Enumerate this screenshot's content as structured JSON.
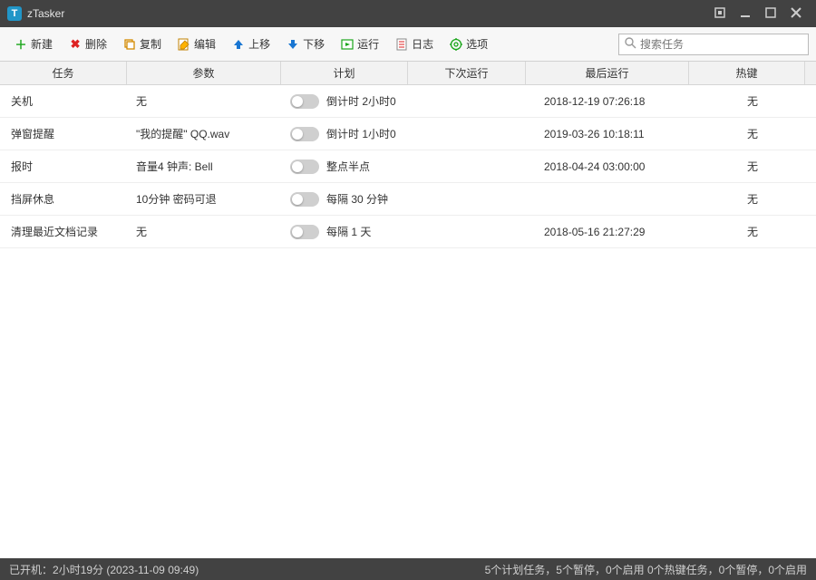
{
  "app": {
    "title": "zTasker"
  },
  "toolbar": {
    "new_label": "新建",
    "delete_label": "删除",
    "copy_label": "复制",
    "edit_label": "编辑",
    "up_label": "上移",
    "down_label": "下移",
    "run_label": "运行",
    "log_label": "日志",
    "options_label": "选项"
  },
  "search": {
    "placeholder": "搜索任务"
  },
  "columns": {
    "task": "任务",
    "param": "参数",
    "plan": "计划",
    "next": "下次运行",
    "last": "最后运行",
    "hotkey": "热键"
  },
  "tasks": [
    {
      "name": "关机",
      "param": "无",
      "enabled": false,
      "plan": "倒计时 2小时0",
      "next": "",
      "last": "2018-12-19 07:26:18",
      "hotkey": "无"
    },
    {
      "name": "弹窗提醒",
      "param": "\"我的提醒\" QQ.wav",
      "enabled": false,
      "plan": "倒计时 1小时0",
      "next": "",
      "last": "2019-03-26 10:18:11",
      "hotkey": "无"
    },
    {
      "name": "报时",
      "param": "音量4 钟声: Bell",
      "enabled": false,
      "plan": "整点半点",
      "next": "",
      "last": "2018-04-24 03:00:00",
      "hotkey": "无"
    },
    {
      "name": "挡屏休息",
      "param": "10分钟 密码可退",
      "enabled": false,
      "plan": "每隔 30 分钟",
      "next": "",
      "last": "",
      "hotkey": "无"
    },
    {
      "name": "清理最近文档记录",
      "param": "无",
      "enabled": false,
      "plan": "每隔 1 天",
      "next": "",
      "last": "2018-05-16 21:27:29",
      "hotkey": "无"
    }
  ],
  "status": {
    "uptime_label": "已开机：",
    "uptime_value": "2小时19分 (2023-11-09 09:49)",
    "summary": "5个计划任务，5个暂停，0个启用    0个热键任务，0个暂停，0个启用"
  }
}
